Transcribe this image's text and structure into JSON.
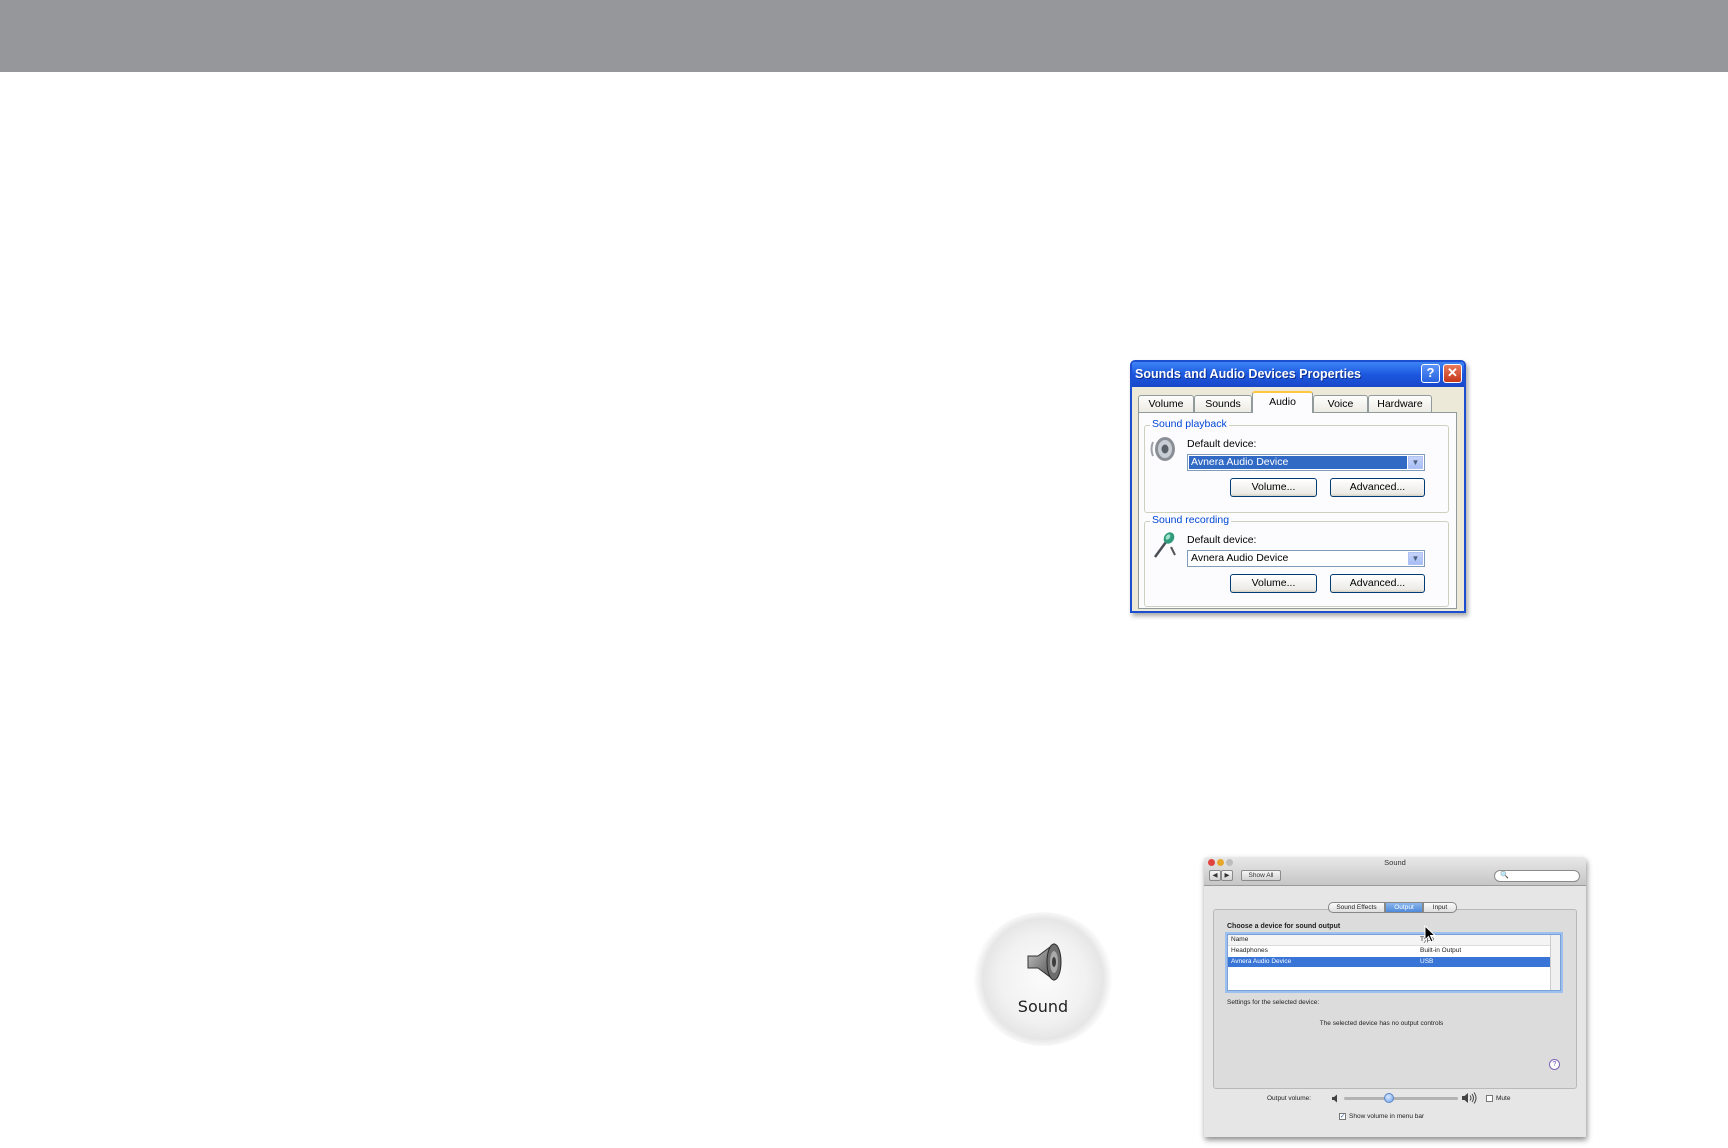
{
  "xp_dialog": {
    "title": "Sounds and Audio Devices Properties",
    "help_button": "?",
    "close_button": "✕",
    "tabs": [
      {
        "label": "Volume",
        "active": false
      },
      {
        "label": "Sounds",
        "active": false
      },
      {
        "label": "Audio",
        "active": true
      },
      {
        "label": "Voice",
        "active": false
      },
      {
        "label": "Hardware",
        "active": false
      }
    ],
    "playback": {
      "group_label": "Sound playback",
      "icon": "speaker-icon",
      "default_device_label": "Default device:",
      "device_value": "Avnera Audio Device",
      "volume_button": "Volume...",
      "advanced_button": "Advanced..."
    },
    "recording": {
      "group_label": "Sound recording",
      "icon": "microphone-icon",
      "default_device_label": "Default device:",
      "device_value": "Avnera Audio Device",
      "volume_button": "Volume...",
      "advanced_button": "Advanced..."
    },
    "dropdown_arrow": "▼"
  },
  "sound_icon": {
    "label": "Sound",
    "icon": "speaker-icon"
  },
  "mac_prefs": {
    "title": "Sound",
    "back_button": "◀",
    "forward_button": "▶",
    "show_all_button": "Show All",
    "search_icon": "🔍",
    "segments": [
      {
        "label": "Sound Effects",
        "active": false
      },
      {
        "label": "Output",
        "active": true
      },
      {
        "label": "Input",
        "active": false
      }
    ],
    "heading": "Choose a device for sound output",
    "table": {
      "columns": [
        "Name",
        "Type"
      ],
      "rows": [
        {
          "name": "Headphones",
          "type": "Built-in Output",
          "selected": false
        },
        {
          "name": "Avnera Audio Device",
          "type": "USB",
          "selected": true
        }
      ]
    },
    "settings_label": "Settings for the selected device:",
    "no_controls_text": "The selected device has no output controls",
    "help_button": "?",
    "output_volume_label": "Output volume:",
    "output_volume_level": 0.38,
    "mute_label": "Mute",
    "mute_checked": false,
    "show_volume_label": "Show volume in menu bar",
    "show_volume_checked": true,
    "checkmark": "✓"
  },
  "colors": {
    "xp_title_blue": "#1c58df",
    "xp_group_label": "#0046d5",
    "mac_selection": "#3875d7",
    "top_bar": "#96979a"
  }
}
